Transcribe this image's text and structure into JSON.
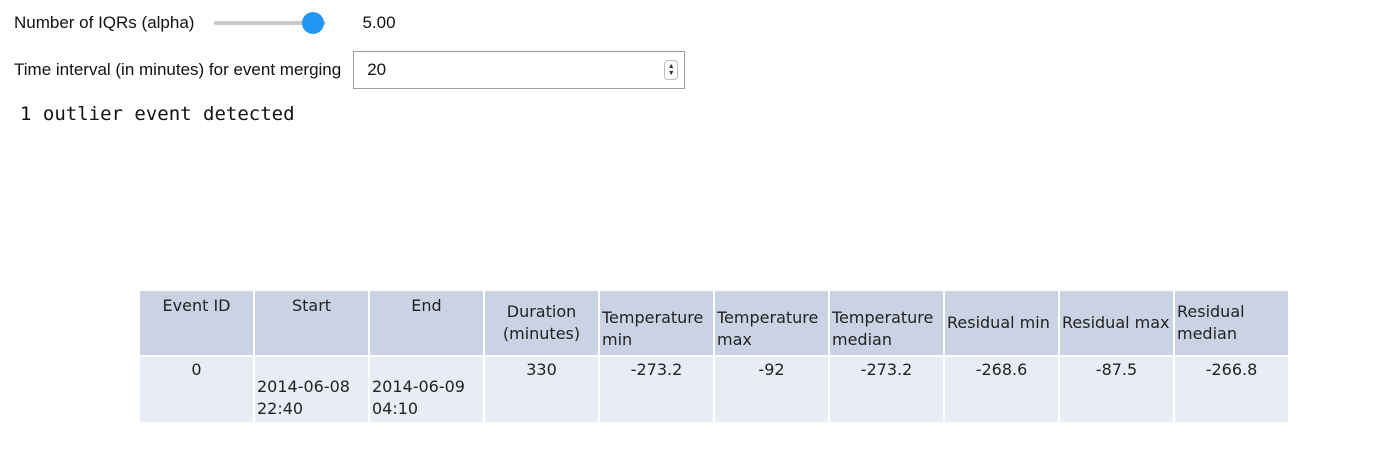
{
  "alpha_control": {
    "label": "Number of IQRs (alpha)",
    "value_text": "5.00",
    "level": 0.88
  },
  "interval_control": {
    "label": "Time interval (in minutes) for event merging",
    "value": "20"
  },
  "output": {
    "message": "1 outlier event detected"
  },
  "table": {
    "headers": {
      "event_id": "Event ID",
      "start": "Start",
      "end": "End",
      "duration": "Duration (minutes)",
      "temp_min": "Temperature min",
      "temp_max": "Temperature max",
      "temp_median": "Temperature median",
      "res_min": "Residual min",
      "res_max": "Residual max",
      "res_median": "Residual median"
    },
    "rows": [
      {
        "event_id": "0",
        "start": "2014-06-08 22:40",
        "end": "2014-06-09 04:10",
        "duration": "330",
        "temp_min": "-273.2",
        "temp_max": "-92",
        "temp_median": "-273.2",
        "res_min": "-268.6",
        "res_max": "-87.5",
        "res_median": "-266.8"
      }
    ]
  },
  "colors": {
    "slider_handle": "#2196f3",
    "header_bg": "#c9d3e3",
    "row_bg": "#e8ecf5"
  }
}
